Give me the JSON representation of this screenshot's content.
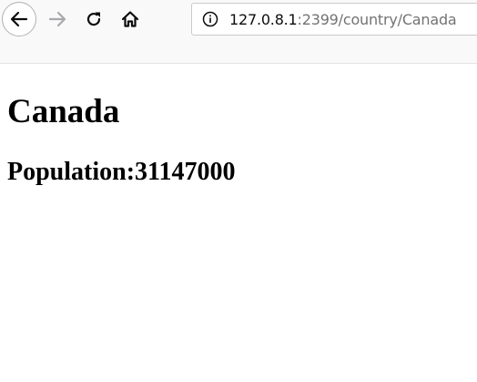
{
  "browser": {
    "icons": {
      "back": "back-arrow-icon",
      "forward": "forward-arrow-icon",
      "reload": "reload-icon",
      "home": "home-icon",
      "info": "info-icon"
    },
    "url": {
      "host": "127.0.8.1",
      "rest": ":2399/country/Canada"
    }
  },
  "page": {
    "heading": "Canada",
    "population_label": "Population:",
    "population_value": "31147000"
  }
}
